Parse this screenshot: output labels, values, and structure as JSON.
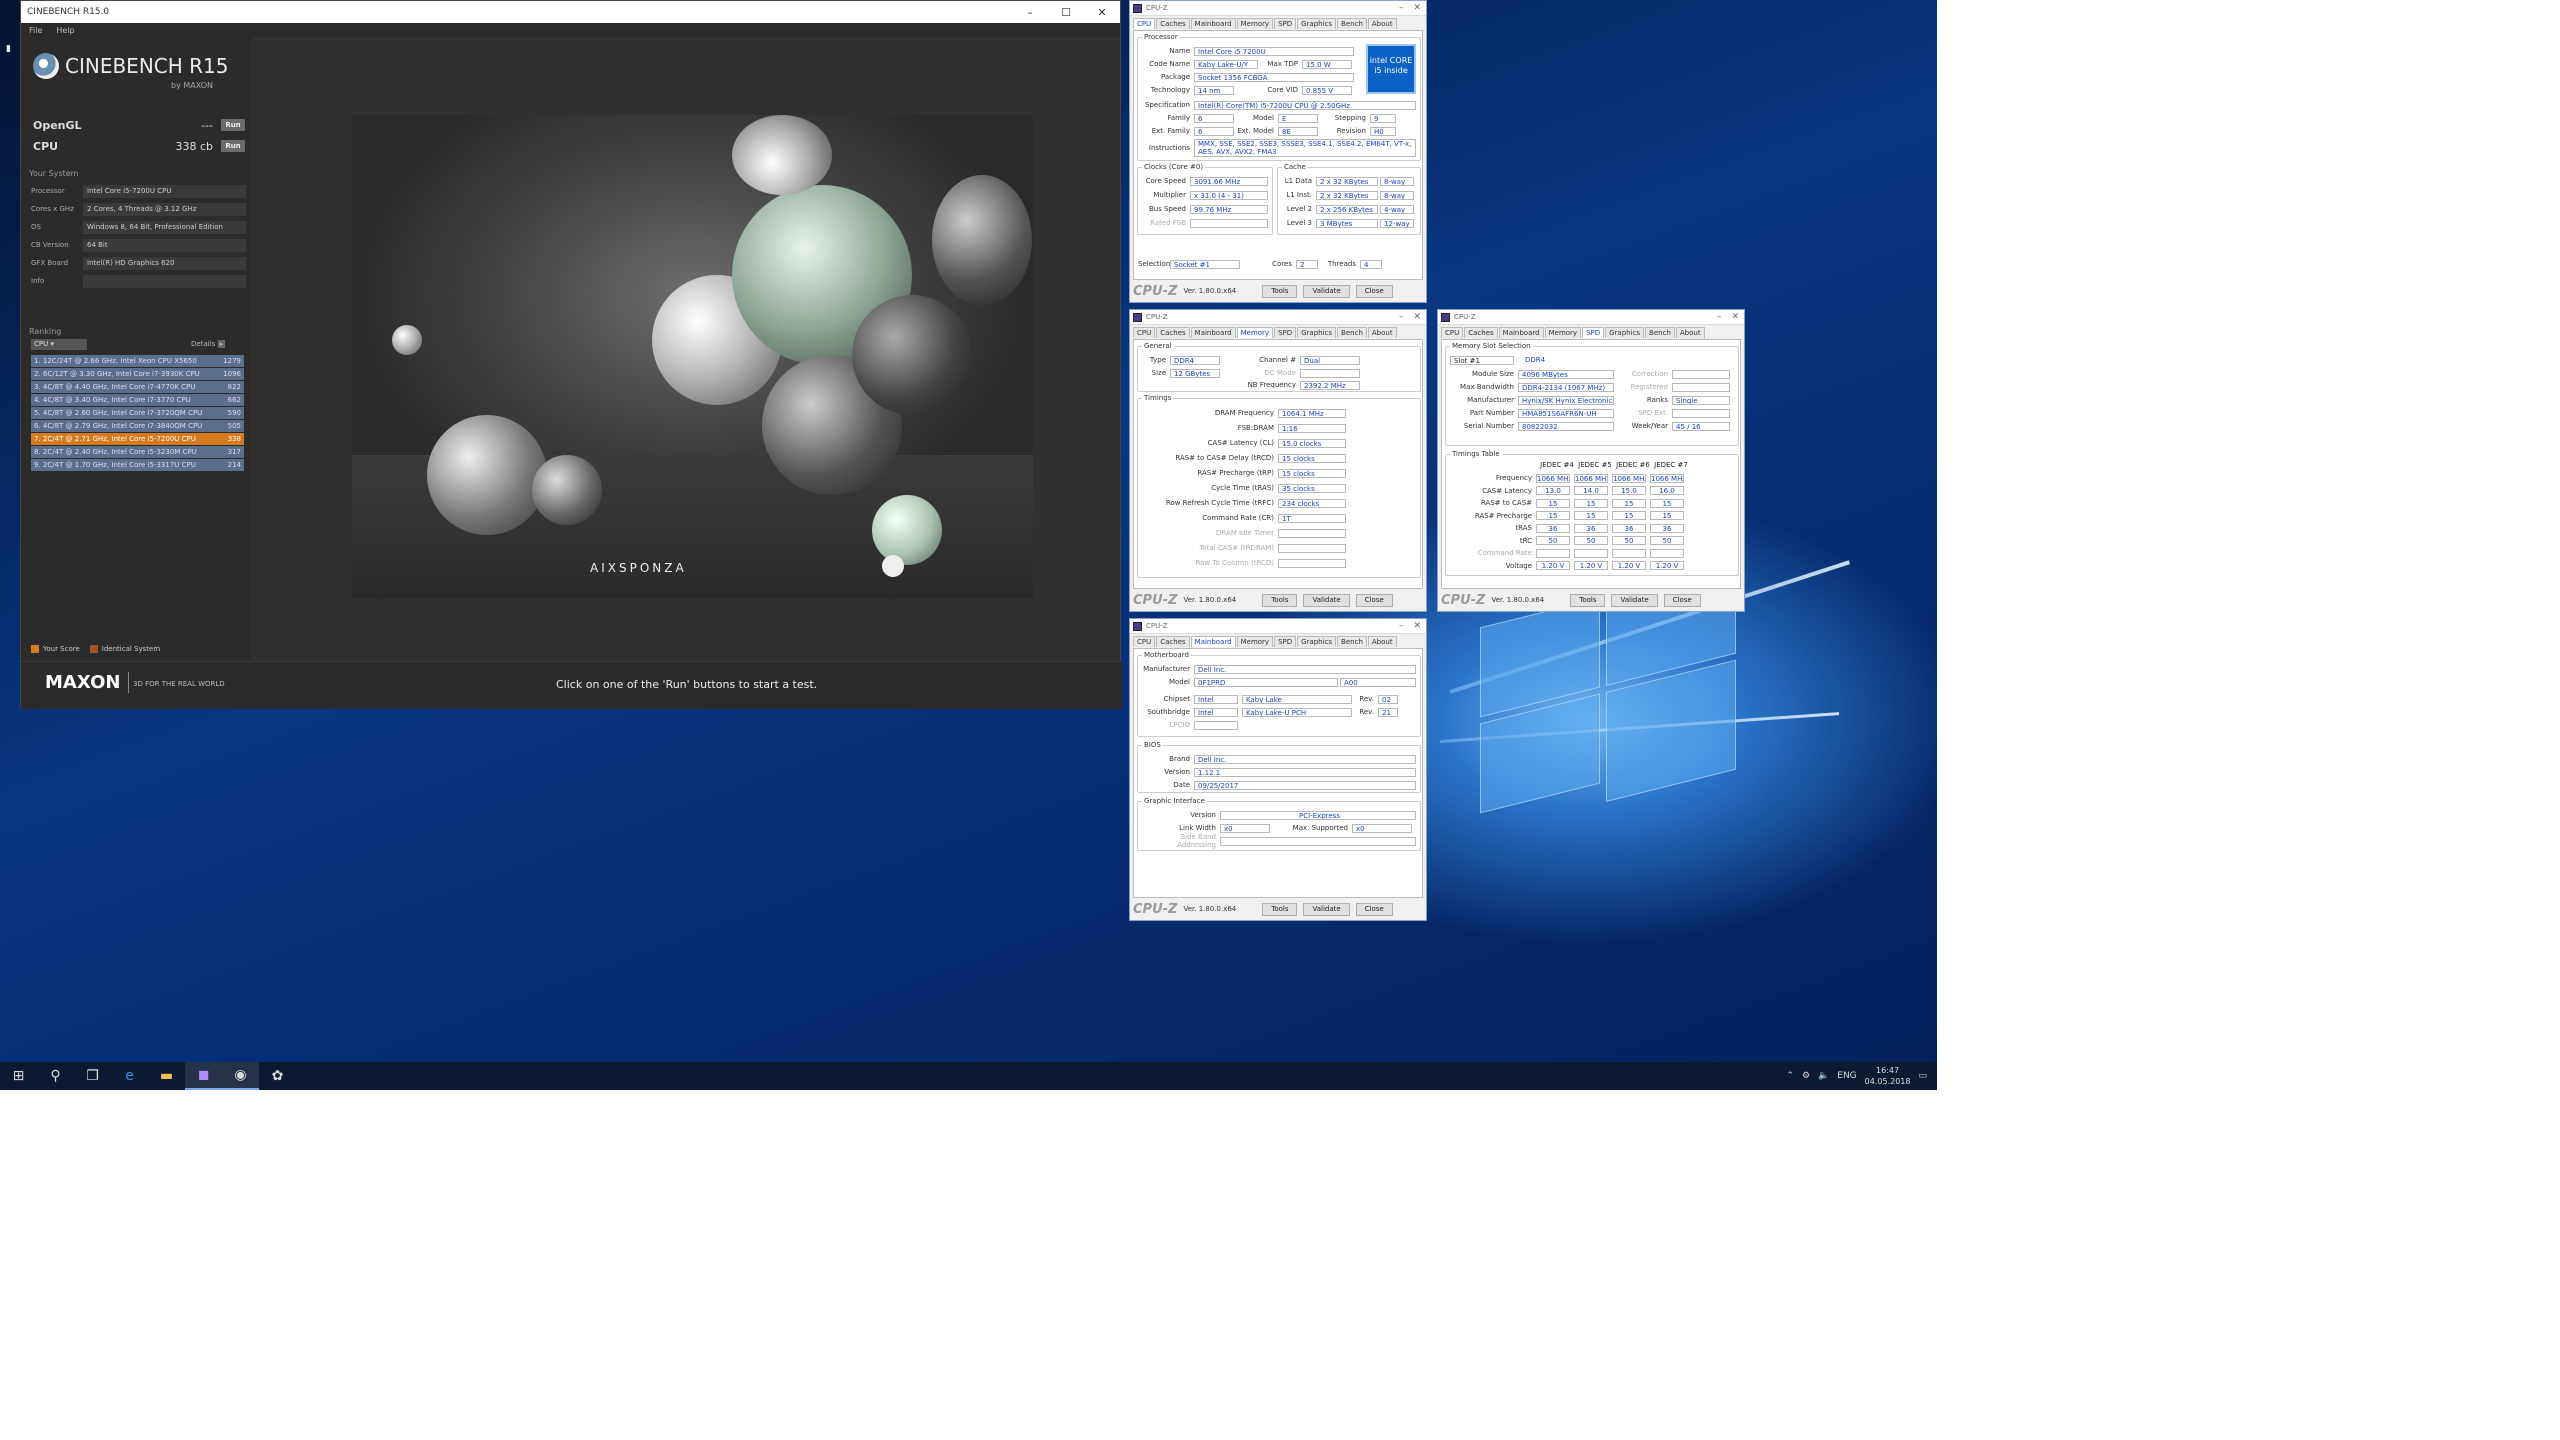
{
  "cinebench": {
    "window_title": "CINEBENCH R15.0",
    "menu": [
      "File",
      "Help"
    ],
    "logo_name": "CINEBENCH R15",
    "logo_by": "by MAXON",
    "opengl": {
      "label": "OpenGL",
      "value": "---",
      "run": "Run"
    },
    "cpu": {
      "label": "CPU",
      "value": "338 cb",
      "run": "Run"
    },
    "system_title": "Your System",
    "system": [
      {
        "k": "Processor",
        "v": "Intel Core i5-7200U CPU"
      },
      {
        "k": "Cores x GHz",
        "v": "2 Cores, 4 Threads @ 3.12 GHz"
      },
      {
        "k": "OS",
        "v": "Windows 8, 64 Bit, Professional Edition"
      },
      {
        "k": "CB Version",
        "v": "64 Bit"
      },
      {
        "k": "GFX Board",
        "v": "Intel(R) HD Graphics 620"
      },
      {
        "k": "Info",
        "v": ""
      }
    ],
    "ranking_title": "Ranking",
    "ranking_select": "CPU",
    "details_label": "Details",
    "ranking": [
      {
        "t": "1. 12C/24T @ 2.66 GHz, Intel Xeon CPU X5650",
        "s": "1279"
      },
      {
        "t": "2. 6C/12T @ 3.30 GHz, Intel Core i7-3930K CPU",
        "s": "1096"
      },
      {
        "t": "3. 4C/8T @ 4.40 GHz, Intel Core i7-4770K CPU",
        "s": "822"
      },
      {
        "t": "4. 4C/8T @ 3.40 GHz, Intel Core i7-3770 CPU",
        "s": "662"
      },
      {
        "t": "5. 4C/8T @ 2.60 GHz, Intel Core i7-3720QM CPU",
        "s": "590"
      },
      {
        "t": "6. 4C/8T @ 2.79 GHz, Intel Core i7-3840QM CPU",
        "s": "505"
      },
      {
        "t": "7. 2C/4T @ 2.71 GHz, Intel Core i5-7200U CPU",
        "s": "338"
      },
      {
        "t": "8. 2C/4T @ 2.40 GHz, Intel Core i5-3230M CPU",
        "s": "317"
      },
      {
        "t": "9. 2C/4T @ 1.70 GHz, Intel Core i5-3317U CPU",
        "s": "214"
      }
    ],
    "legend": {
      "your_score": "Your Score",
      "identical": "Identical System"
    },
    "footer_brand": "MAXON",
    "footer_tag": "3D FOR THE REAL WORLD",
    "status": "Click on one of the 'Run' buttons to start a test.",
    "render_watermark": "AIXSPONZA"
  },
  "cpuz_common": {
    "title": "CPU-Z",
    "tabs": [
      "CPU",
      "Caches",
      "Mainboard",
      "Memory",
      "SPD",
      "Graphics",
      "Bench",
      "About"
    ],
    "brand": "CPU-Z",
    "version": "Ver. 1.80.0.x64",
    "tools": "Tools",
    "validate": "Validate",
    "close": "Close"
  },
  "cpuz_cpu": {
    "processor_group": "Processor",
    "name": {
      "k": "Name",
      "v": "Intel Core i5 7200U"
    },
    "codename": {
      "k": "Code Name",
      "v": "Kaby Lake-U/Y"
    },
    "maxtdp": {
      "k": "Max TDP",
      "v": "15.0 W"
    },
    "package": {
      "k": "Package",
      "v": "Socket 1356 FCBGA"
    },
    "technology": {
      "k": "Technology",
      "v": "14 nm"
    },
    "corevid": {
      "k": "Core VID",
      "v": "0.855 V"
    },
    "spec": {
      "k": "Specification",
      "v": "Intel(R) Core(TM) i5-7200U CPU @ 2.50GHz"
    },
    "family": {
      "k": "Family",
      "v": "6"
    },
    "model": {
      "k": "Model",
      "v": "E"
    },
    "stepping": {
      "k": "Stepping",
      "v": "9"
    },
    "extfamily": {
      "k": "Ext. Family",
      "v": "6"
    },
    "extmodel": {
      "k": "Ext. Model",
      "v": "8E"
    },
    "revision": {
      "k": "Revision",
      "v": "H0"
    },
    "instructions": {
      "k": "Instructions",
      "v": "MMX, SSE, SSE2, SSE3, SSSE3, SSE4.1, SSE4.2, EM64T, VT-x, AES, AVX, AVX2, FMA3"
    },
    "clocks_group": "Clocks (Core #0)",
    "corespeed": {
      "k": "Core Speed",
      "v": "3091.66 MHz"
    },
    "multiplier": {
      "k": "Multiplier",
      "v": "x 31.0 (4 - 31)"
    },
    "busspeed": {
      "k": "Bus Speed",
      "v": "99.76 MHz"
    },
    "ratedfsb": {
      "k": "Rated FSB",
      "v": ""
    },
    "cache_group": "Cache",
    "l1d": {
      "k": "L1 Data",
      "v": "2 x 32 KBytes",
      "w": "8-way"
    },
    "l1i": {
      "k": "L1 Inst.",
      "v": "2 x 32 KBytes",
      "w": "8-way"
    },
    "l2": {
      "k": "Level 2",
      "v": "2 x 256 KBytes",
      "w": "4-way"
    },
    "l3": {
      "k": "Level 3",
      "v": "3 MBytes",
      "w": "12-way"
    },
    "selection": {
      "k": "Selection",
      "v": "Socket #1"
    },
    "cores": {
      "k": "Cores",
      "v": "2"
    },
    "threads": {
      "k": "Threads",
      "v": "4"
    },
    "intel_badge": "intel CORE i5 inside"
  },
  "cpuz_memory": {
    "general_group": "General",
    "type": {
      "k": "Type",
      "v": "DDR4"
    },
    "channel": {
      "k": "Channel #",
      "v": "Dual"
    },
    "size": {
      "k": "Size",
      "v": "12 GBytes"
    },
    "dcmode": {
      "k": "DC Mode",
      "v": ""
    },
    "nbfreq": {
      "k": "NB Frequency",
      "v": "2392.2 MHz"
    },
    "timings_group": "Timings",
    "timings": [
      {
        "k": "DRAM Frequency",
        "v": "1064.1 MHz"
      },
      {
        "k": "FSB:DRAM",
        "v": "1:16"
      },
      {
        "k": "CAS# Latency (CL)",
        "v": "15.0 clocks"
      },
      {
        "k": "RAS# to CAS# Delay (tRCD)",
        "v": "15 clocks"
      },
      {
        "k": "RAS# Precharge (tRP)",
        "v": "15 clocks"
      },
      {
        "k": "Cycle Time (tRAS)",
        "v": "35 clocks"
      },
      {
        "k": "Row Refresh Cycle Time (tRFC)",
        "v": "234 clocks"
      },
      {
        "k": "Command Rate (CR)",
        "v": "1T"
      },
      {
        "k": "DRAM Idle Timer",
        "v": ""
      },
      {
        "k": "Total CAS# (tRDRAM)",
        "v": ""
      },
      {
        "k": "Row To Column (tRCD)",
        "v": ""
      }
    ]
  },
  "cpuz_mainboard": {
    "group": "Motherboard",
    "manufacturer": {
      "k": "Manufacturer",
      "v": "Dell Inc."
    },
    "model": {
      "k": "Model",
      "v": "0F1PRD",
      "r": "A00"
    },
    "chipset": {
      "k": "Chipset",
      "v": "Intel",
      "v2": "Kaby Lake",
      "rk": "Rev.",
      "r": "02"
    },
    "southbridge": {
      "k": "Southbridge",
      "v": "Intel",
      "v2": "Kaby Lake-U PCH",
      "rk": "Rev.",
      "r": "21"
    },
    "lpcio": {
      "k": "LPCIO",
      "v": ""
    },
    "bios_group": "BIOS",
    "brand": {
      "k": "Brand",
      "v": "Dell Inc."
    },
    "version": {
      "k": "Version",
      "v": "1.12.1"
    },
    "date": {
      "k": "Date",
      "v": "09/25/2017"
    },
    "gi_group": "Graphic Interface",
    "gi_version": {
      "k": "Version",
      "v": "PCI-Express"
    },
    "linkwidth": {
      "k": "Link Width",
      "v": "x0"
    },
    "maxsupported": {
      "k": "Max. Supported",
      "v": "x0"
    },
    "sideband": {
      "k": "Side Band Addressing",
      "v": ""
    }
  },
  "cpuz_spd": {
    "slot_group": "Memory Slot Selection",
    "slot": "Slot #1",
    "slot_type": "DDR4",
    "modulesize": {
      "k": "Module Size",
      "v": "4096 MBytes"
    },
    "maxbw": {
      "k": "Max Bandwidth",
      "v": "DDR4-2134 (1067 MHz)"
    },
    "manufacturer": {
      "k": "Manufacturer",
      "v": "Hynix/SK Hynix Electronics"
    },
    "partnumber": {
      "k": "Part Number",
      "v": "HMA851S6AFR6N-UH"
    },
    "serial": {
      "k": "Serial Number",
      "v": "80822032"
    },
    "correction": {
      "k": "Correction",
      "v": ""
    },
    "registered": {
      "k": "Registered",
      "v": ""
    },
    "ranks": {
      "k": "Ranks",
      "v": "Single"
    },
    "spdext": {
      "k": "SPD Ext.",
      "v": ""
    },
    "weekyear": {
      "k": "Week/Year",
      "v": "45 / 16"
    },
    "timings_group": "Timings Table",
    "cols": [
      "JEDEC #4",
      "JEDEC #5",
      "JEDEC #6",
      "JEDEC #7"
    ],
    "rows": [
      {
        "k": "Frequency",
        "v": [
          "1066 MHz",
          "1066 MHz",
          "1066 MHz",
          "1066 MHz"
        ]
      },
      {
        "k": "CAS# Latency",
        "v": [
          "13.0",
          "14.0",
          "15.0",
          "16.0"
        ]
      },
      {
        "k": "RAS# to CAS#",
        "v": [
          "15",
          "15",
          "15",
          "15"
        ]
      },
      {
        "k": "RAS# Precharge",
        "v": [
          "15",
          "15",
          "15",
          "15"
        ]
      },
      {
        "k": "tRAS",
        "v": [
          "36",
          "36",
          "36",
          "36"
        ]
      },
      {
        "k": "tRC",
        "v": [
          "50",
          "50",
          "50",
          "50"
        ]
      },
      {
        "k": "Command Rate",
        "v": [
          "",
          "",
          "",
          ""
        ]
      },
      {
        "k": "Voltage",
        "v": [
          "1.20 V",
          "1.20 V",
          "1.20 V",
          "1.20 V"
        ]
      }
    ],
    "version": "Ver. 1.80.0.x64"
  },
  "taskbar": {
    "lang": "ENG",
    "time": "16:47",
    "date": "04.05.2018"
  }
}
